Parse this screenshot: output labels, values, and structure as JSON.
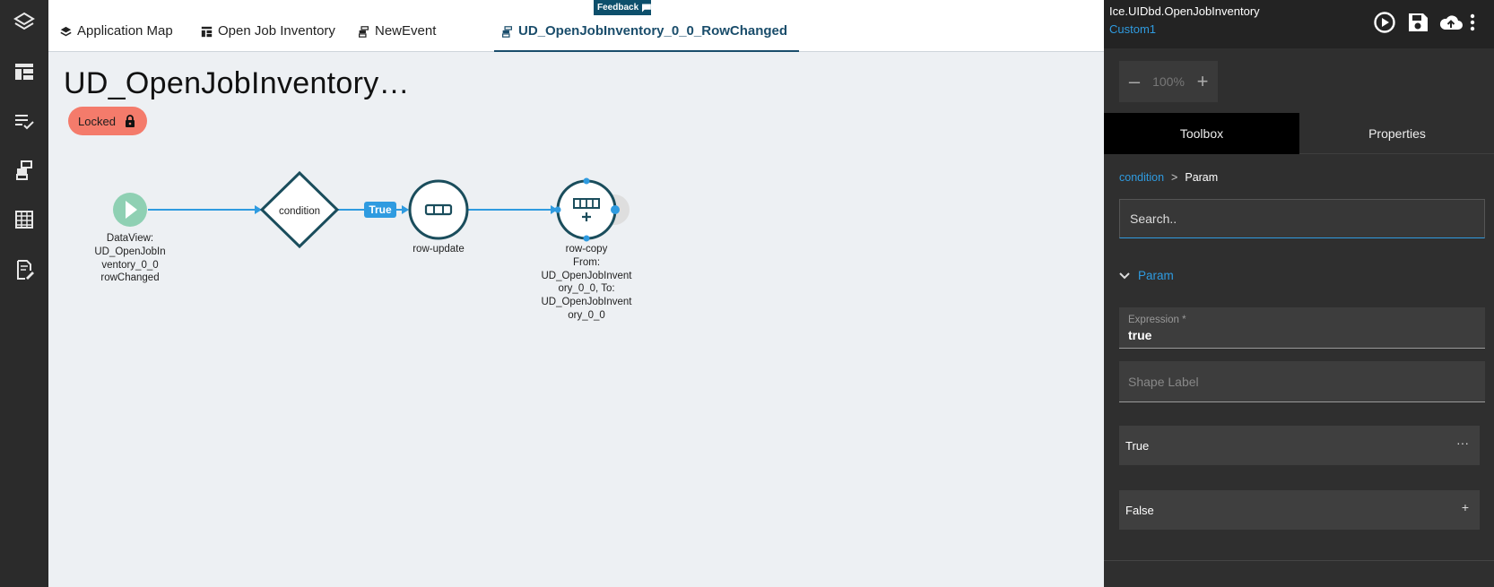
{
  "feedback": {
    "label": "Feedback"
  },
  "tabs": [
    {
      "label": "Application Map",
      "icon": "layers-icon"
    },
    {
      "label": "Open Job Inventory",
      "icon": "table-icon"
    },
    {
      "label": "NewEvent",
      "icon": "event-icon"
    },
    {
      "label": "UD_OpenJobInventory_0_0_RowChanged",
      "icon": "event-icon",
      "active": true
    }
  ],
  "canvas": {
    "title": "UD_OpenJobInventory…",
    "locked_label": "Locked"
  },
  "flow": {
    "start_label": [
      "DataView:",
      "UD_OpenJobIn",
      "ventory_0_0",
      "rowChanged"
    ],
    "condition_label": "condition",
    "true_badge": "True",
    "update_label": "row-update",
    "copy_label": [
      "row-copy",
      "From:",
      "UD_OpenJobInvent",
      "ory_0_0, To:",
      "UD_OpenJobInvent",
      "ory_0_0"
    ]
  },
  "panel": {
    "app_name": "Ice.UIDbd.OpenJobInventory",
    "layer_name": "Custom1",
    "zoom": "100%",
    "tabs": [
      "Toolbox",
      "Properties"
    ],
    "breadcrumb": {
      "parent": "condition",
      "separator": ">",
      "current": "Param"
    },
    "search_placeholder": "Search..",
    "section_title": "Param",
    "expression_label": "Expression *",
    "expression_value": "true",
    "shape_label_placeholder": "Shape Label",
    "branch_true": "True",
    "branch_true_action": "···",
    "branch_false": "False",
    "branch_false_action": "+"
  },
  "colors": {
    "accent": "#2f9be0",
    "node_stroke": "#1a4d5c",
    "locked": "#f47b6b",
    "start_node": "#8fd0b3"
  }
}
